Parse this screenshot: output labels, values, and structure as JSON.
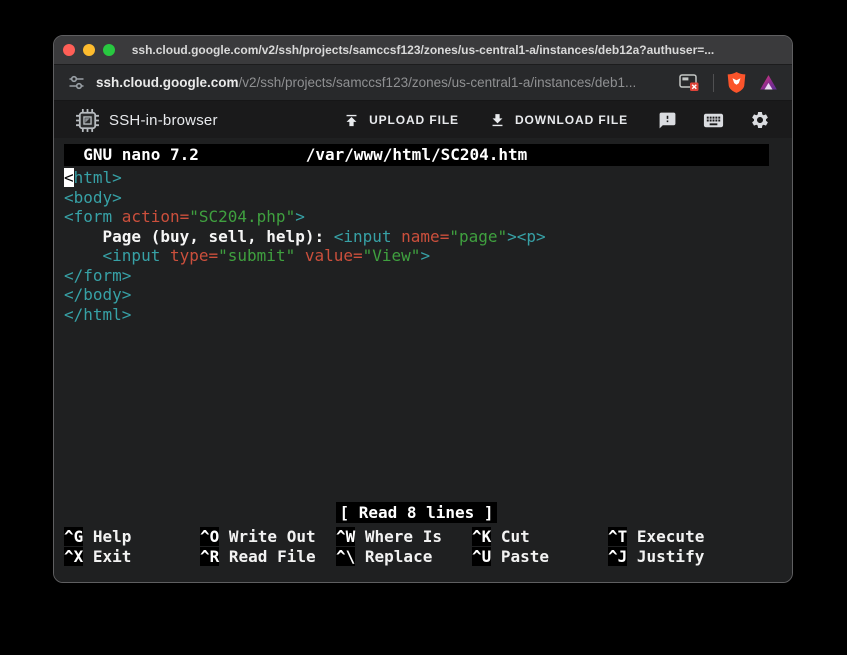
{
  "window": {
    "title": "ssh.cloud.google.com/v2/ssh/projects/samccsf123/zones/us-central1-a/instances/deb12a?authuser=..."
  },
  "address_bar": {
    "domain": "ssh.cloud.google.com",
    "path": "/v2/ssh/projects/samccsf123/zones/us-central1-a/instances/deb1..."
  },
  "header": {
    "app_title": "SSH-in-browser",
    "upload_label": "UPLOAD FILE",
    "download_label": "DOWNLOAD FILE"
  },
  "colors": {
    "traffic_red": "#ff5f57",
    "traffic_yellow": "#febc2e",
    "traffic_green": "#28c840",
    "brave_shield": "#fb542b",
    "terminal_bg": "#1f2021",
    "syntax": {
      "tag": "#37a1a6",
      "attr": "#cb4f3c",
      "str": "#3fa03f",
      "text": "#f5f5f5"
    }
  },
  "terminal": {
    "editor_title_left": "  GNU nano 7.2",
    "editor_title_file": "/var/www/html/SC204.htm",
    "status": "[ Read 8 lines ]",
    "lines": [
      [
        {
          "t": "<",
          "c": "cursor"
        },
        {
          "t": "html>",
          "c": "tag"
        }
      ],
      [
        {
          "t": "<body>",
          "c": "tag"
        }
      ],
      [
        {
          "t": "<form ",
          "c": "tag"
        },
        {
          "t": "action=",
          "c": "attr"
        },
        {
          "t": "\"SC204.php\"",
          "c": "str"
        },
        {
          "t": ">",
          "c": "tag"
        }
      ],
      [
        {
          "t": "    Page (buy, sell, help): ",
          "c": "text"
        },
        {
          "t": "<input ",
          "c": "tag"
        },
        {
          "t": "name=",
          "c": "attr"
        },
        {
          "t": "\"page\"",
          "c": "str"
        },
        {
          "t": "><p>",
          "c": "tag"
        }
      ],
      [
        {
          "t": "    <input ",
          "c": "tag"
        },
        {
          "t": "type=",
          "c": "attr"
        },
        {
          "t": "\"submit\"",
          "c": "str"
        },
        {
          "t": " ",
          "c": "tag"
        },
        {
          "t": "value=",
          "c": "attr"
        },
        {
          "t": "\"View\"",
          "c": "str"
        },
        {
          "t": ">",
          "c": "tag"
        }
      ],
      [
        {
          "t": "</form>",
          "c": "tag"
        }
      ],
      [
        {
          "t": "</body>",
          "c": "tag"
        }
      ],
      [
        {
          "t": "</html>",
          "c": "tag"
        }
      ]
    ],
    "shortcut_rows": [
      [
        {
          "key": "^G",
          "label": "Help"
        },
        {
          "key": "^O",
          "label": "Write Out"
        },
        {
          "key": "^W",
          "label": "Where Is"
        },
        {
          "key": "^K",
          "label": "Cut"
        },
        {
          "key": "^T",
          "label": "Execute"
        }
      ],
      [
        {
          "key": "^X",
          "label": "Exit"
        },
        {
          "key": "^R",
          "label": "Read File"
        },
        {
          "key": "^\\",
          "label": "Replace"
        },
        {
          "key": "^U",
          "label": "Paste"
        },
        {
          "key": "^J",
          "label": "Justify"
        }
      ]
    ]
  }
}
